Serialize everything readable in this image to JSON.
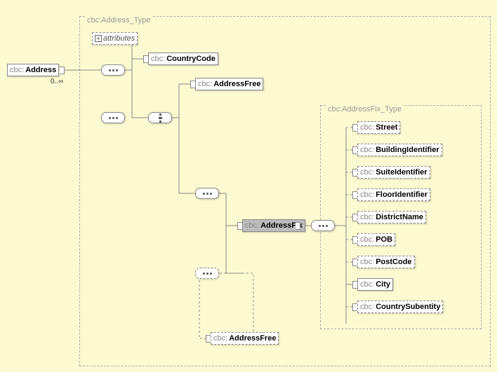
{
  "root": {
    "ns": "cbc:",
    "name": "Address",
    "cardinality": "0..∞"
  },
  "group_main": {
    "label": "cbc:Address_Type"
  },
  "attributes": {
    "label": "attributes"
  },
  "country_code": {
    "ns": "cbc:",
    "name": "CountryCode"
  },
  "address_free_top": {
    "ns": "cbc:",
    "name": "AddressFree"
  },
  "address_fix": {
    "ns": "cbc:",
    "name": "AddressFix"
  },
  "address_free_bottom": {
    "ns": "cbc:",
    "name": "AddressFree"
  },
  "group_fix": {
    "label": "cbc:AddressFix_Type"
  },
  "fix_children": {
    "street": {
      "ns": "cbc:",
      "name": "Street"
    },
    "building": {
      "ns": "cbc:",
      "name": "BuildingIdentifier"
    },
    "suite": {
      "ns": "cbc:",
      "name": "SuiteIdentifier"
    },
    "floor": {
      "ns": "cbc:",
      "name": "FloorIdentifier"
    },
    "district": {
      "ns": "cbc:",
      "name": "DistrictName"
    },
    "pob": {
      "ns": "cbc:",
      "name": "POB"
    },
    "postcode": {
      "ns": "cbc:",
      "name": "PostCode"
    },
    "city": {
      "ns": "cbc:",
      "name": "City"
    },
    "subentity": {
      "ns": "cbc:",
      "name": "CountrySubentity"
    }
  }
}
